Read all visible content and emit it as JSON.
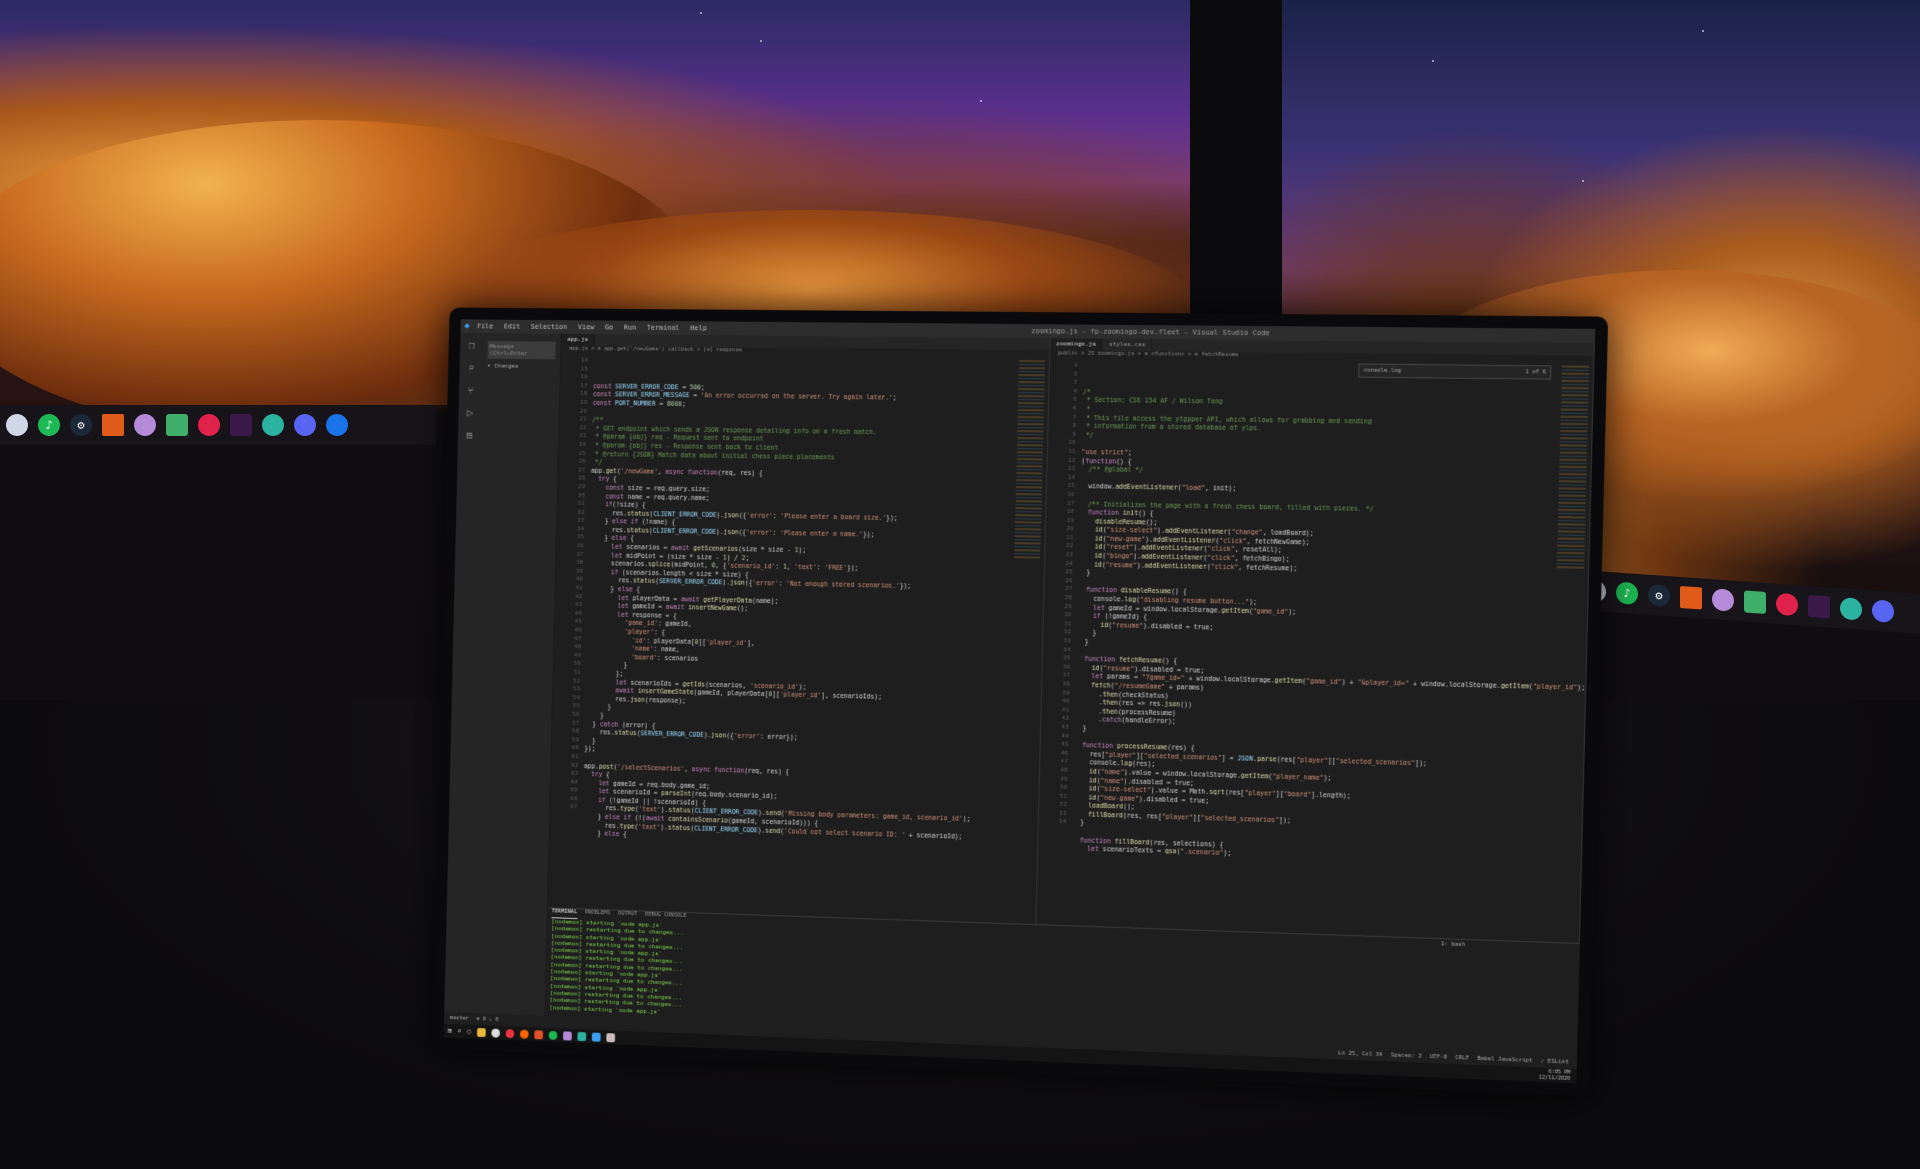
{
  "window": {
    "menu": [
      "File",
      "Edit",
      "Selection",
      "View",
      "Go",
      "Run",
      "Terminal",
      "Help"
    ],
    "title": "zoomingo.js - fp-zoomingo-dev.fleet - Visual Studio Code"
  },
  "sidebar": {
    "message_placeholder": "Message (Ctrl+Enter",
    "section": "Changes"
  },
  "left_editor": {
    "tab": "app.js",
    "breadcrumb": "app.js > ⊘ app.get('/newGame') callback > [e] response",
    "lines": [
      "const SERVER_ERROR_CODE = 500;",
      "const SERVER_ERROR_MESSAGE = 'An error occurred on the server. Try again later.';",
      "const PORT_NUMBER = 8000;",
      "",
      "/**",
      " * GET endpoint which sends a JSON response detailing info on a fresh match.",
      " * @param {obj} req - Request sent to endpoint",
      " * @param {obj} res - Response sent back to client",
      " * @return {JSON} Match data about initial chess piece placements",
      " */",
      "app.get('/newGame', async function(req, res) {",
      "  try {",
      "    const size = req.query.size;",
      "    const name = req.query.name;",
      "    if(!size) {",
      "      res.status(CLIENT_ERROR_CODE).json({'error': 'Please enter a board size.'});",
      "    } else if (!name) {",
      "      res.status(CLIENT_ERROR_CODE).json({'error': 'Please enter a name.'});",
      "    } else {",
      "      let scenarios = await getScenarios(size * size - 1);",
      "      let midPoint = (size * size - 1) / 2;",
      "      scenarios.splice(midPoint, 0, {'scenario_id': 1, 'text': 'FREE'});",
      "      if (scenarios.length < size * size) {",
      "        res.status(SERVER_ERROR_CODE).json({'error': 'Not enough stored scenarios.'});",
      "      } else {",
      "        let playerData = await getPlayerData(name);",
      "        let gameId = await insertNewGame();",
      "        let response = {",
      "          'game_id': gameId,",
      "          'player': {",
      "            'id': playerData[0]['player_id'],",
      "            'name': name,",
      "            'board': scenarios",
      "          }",
      "        };",
      "        let scenarioIds = getIds(scenarios, 'scenario_id');",
      "        await insertGameState(gameId, playerData[0]['player_id'], scenarioIds);",
      "        res.json(response);",
      "      }",
      "    }",
      "  } catch (error) {",
      "    res.status(SERVER_ERROR_CODE).json({'error': error});",
      "  }",
      "});",
      "",
      "app.post('/selectScenarios', async function(req, res) {",
      "  try {",
      "    let gameId = req.body.game_id;",
      "    let scenarioId = parseInt(req.body.scenario_id);",
      "    if (!gameId || !scenarioId) {",
      "      res.type('text').status(CLIENT_ERROR_CODE).send('Missing body parameters: game_id, scenario_id');",
      "    } else if (!(await containsScenario(gameId, scenarioId))) {",
      "      res.type('text').status(CLIENT_ERROR_CODE).send('Could not select scenario ID: ' + scenarioId);",
      "    } else {"
    ],
    "first_line_number": 14
  },
  "right_editor": {
    "tabs": [
      "zoomingo.js",
      "styles.css"
    ],
    "breadcrumb": "public > JS zoomingo.js > ⊘ <function> > ⊘ fetchResume",
    "find_text": "console.log",
    "find_count": "1 of 6",
    "lines": [
      "/*",
      " * Section: CSE 154 AF / Wilson Tang",
      " *",
      " * This file access the ytgpper API, which allows for grabbing and sending",
      " * information from a stored database of ylps.",
      " */",
      "",
      "\"use strict\";",
      "(function() {",
      "  /** @global */",
      "",
      "  window.addEventListener(\"load\", init);",
      "",
      "  /** Initializes the page with a fresh chess board, filled with pieces. */",
      "  function init() {",
      "    disableResume();",
      "    id(\"size-select\").addEventListener(\"change\", loadBoard);",
      "    id(\"new-game\").addEventListener(\"click\", fetchNewGame);",
      "    id(\"reset\").addEventListener(\"click\", resetAll);",
      "    id(\"bingo\").addEventListener(\"click\", fetchBingo);",
      "    id(\"resume\").addEventListener(\"click\", fetchResume);",
      "  }",
      "",
      "  function disableResume() {",
      "    console.log(\"disabling resume button...\");",
      "    let gameId = window.localStorage.getItem(\"game_id\");",
      "    if (!gameId) {",
      "      id(\"resume\").disabled = true;",
      "    }",
      "  }",
      "",
      "  function fetchResume() {",
      "    id(\"resume\").disabled = true;",
      "    let params = \"?game_id=\" + window.localStorage.getItem(\"game_id\") + \"&player_id=\" + window.localStorage.getItem(\"player_id\");",
      "    fetch(\"/resumeGame\" + params)",
      "      .then(checkStatus)",
      "      .then(res => res.json())",
      "      .then(processResume)",
      "      .catch(handleError);",
      "  }",
      "",
      "  function processResume(res) {",
      "    res[\"player\"][\"selected_scenarios\"] = JSON.parse(res[\"player\"][\"selected_scenarios\"]);",
      "    console.log(res);",
      "    id(\"name\").value = window.localStorage.getItem(\"player_name\");",
      "    id(\"name\").disabled = true;",
      "    id(\"size-select\").value = Math.sqrt(res[\"player\"][\"board\"].length);",
      "    id(\"new-game\").disabled = true;",
      "    loadBoard();",
      "    fillBoard(res, res[\"player\"][\"selected_scenarios\"]);",
      "  }",
      "",
      "  function fillBoard(res, selections) {",
      "    let scenarioTexts = qsa(\".scenario\");"
    ],
    "first_line_number": 1
  },
  "terminal": {
    "tabs": [
      "TERMINAL",
      "PROBLEMS",
      "OUTPUT",
      "DEBUG CONSOLE"
    ],
    "lines": [
      "[nodemon] starting `node app.js`",
      "[nodemon] restarting due to changes...",
      "[nodemon] starting `node app.js`",
      "[nodemon] restarting due to changes...",
      "[nodemon] starting `node app.js`",
      "[nodemon] restarting due to changes...",
      "[nodemon] restarting due to changes...",
      "[nodemon] starting `node app.js`",
      "[nodemon] restarting due to changes...",
      "[nodemon] starting `node app.js`",
      "[nodemon] restarting due to changes...",
      "[nodemon] restarting due to changes...",
      "[nodemon] starting `node app.js`"
    ],
    "shell": "1: bash"
  },
  "statusbar": {
    "branch": "master",
    "sync": "⊗ 0 ⚠ 0",
    "position": "Ln 25, Col 34",
    "spaces": "Spaces: 2",
    "encoding": "UTF-8",
    "eol": "CRLF",
    "language": "Babel JavaScript",
    "ext": "✓ ESLint"
  },
  "clock": {
    "time": "6:05 PM",
    "date": "12/11/2020"
  },
  "colors": {
    "accent": "#3a9ff2",
    "terminal_text": "#7fd44e"
  }
}
